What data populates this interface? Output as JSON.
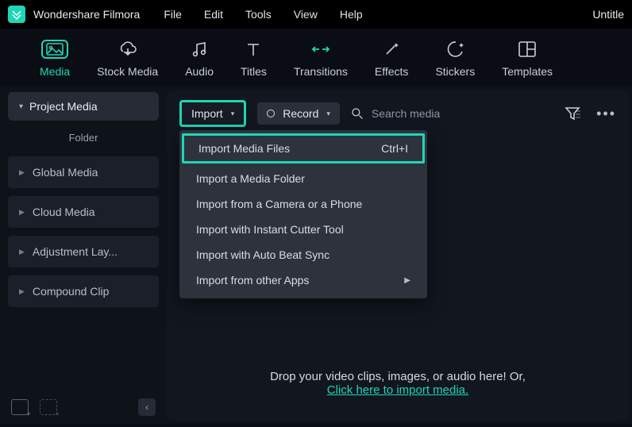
{
  "app": {
    "name": "Wondershare Filmora",
    "doc_title": "Untitle"
  },
  "menubar": {
    "file": "File",
    "edit": "Edit",
    "tools": "Tools",
    "view": "View",
    "help": "Help"
  },
  "tooltabs": {
    "media": "Media",
    "stock": "Stock Media",
    "audio": "Audio",
    "titles": "Titles",
    "transitions": "Transitions",
    "effects": "Effects",
    "stickers": "Stickers",
    "templates": "Templates"
  },
  "sidebar": {
    "header": "Project Media",
    "folder_label": "Folder",
    "items": [
      "Global Media",
      "Cloud Media",
      "Adjustment Lay...",
      "Compound Clip"
    ]
  },
  "toolbar": {
    "import": "Import",
    "record": "Record",
    "search_placeholder": "Search media"
  },
  "import_menu": {
    "items": [
      {
        "label": "Import Media Files",
        "shortcut": "Ctrl+I"
      },
      {
        "label": "Import a Media Folder"
      },
      {
        "label": "Import from a Camera or a Phone"
      },
      {
        "label": "Import with Instant Cutter Tool"
      },
      {
        "label": "Import with Auto Beat Sync"
      },
      {
        "label": "Import from other Apps",
        "submenu": true
      }
    ]
  },
  "drop": {
    "line1": "Drop your video clips, images, or audio here! Or,",
    "link": "Click here to import media."
  }
}
